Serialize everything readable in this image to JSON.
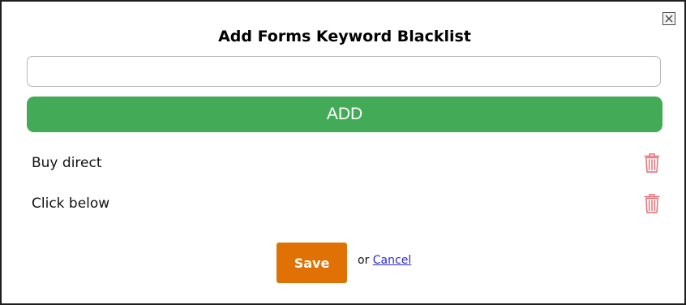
{
  "dialog": {
    "title": "Add Forms Keyword Blacklist",
    "close_icon": "close-icon"
  },
  "input": {
    "value": "",
    "placeholder": ""
  },
  "add_button": {
    "label": "ADD"
  },
  "keywords": [
    {
      "label": "Buy direct",
      "action_icon": "trash-icon"
    },
    {
      "label": "Click below",
      "action_icon": "trash-icon"
    }
  ],
  "footer": {
    "save_label": "Save",
    "or_text": "or",
    "cancel_label": "Cancel"
  },
  "colors": {
    "add_button": "#43ab57",
    "save_button": "#e07205",
    "trash_icon": "#e06a72",
    "cancel_link": "#2a2ad0"
  }
}
